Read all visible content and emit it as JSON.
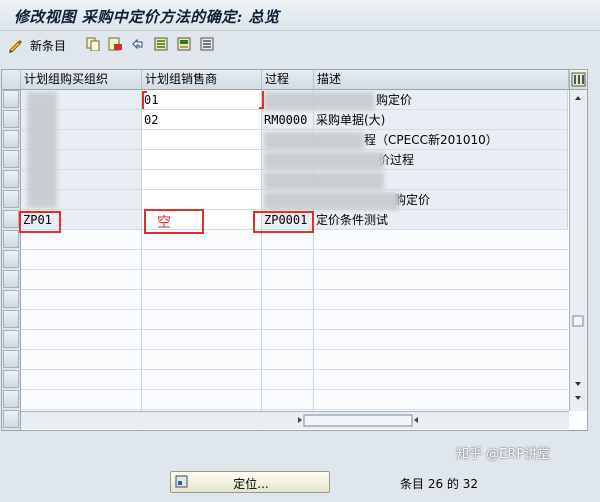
{
  "window": {
    "title": "修改视图 采购中定价方法的确定: 总览"
  },
  "toolbar": {
    "new_entries_label": "新条目",
    "icons": [
      "edit-glasses-icon",
      "copy-icon",
      "delete-icon",
      "undo-icon",
      "select-all-icon",
      "select-block-icon",
      "deselect-all-icon"
    ]
  },
  "table": {
    "columns": [
      "计划组购买组织",
      "计划组销售商",
      "过程",
      "描述"
    ],
    "rows": [
      {
        "purch_org": "",
        "vendor": "01",
        "procedure": "",
        "description": "购定价"
      },
      {
        "purch_org": "",
        "vendor": "02",
        "procedure": "RM0000",
        "description": "采购单据(大)"
      },
      {
        "purch_org": "",
        "vendor": "",
        "procedure": "",
        "description": "程（CPECC新201010）"
      },
      {
        "purch_org": "",
        "vendor": "",
        "procedure": "",
        "description": "价过程"
      },
      {
        "purch_org": "",
        "vendor": "",
        "procedure": "",
        "description": ""
      },
      {
        "purch_org": "",
        "vendor": "",
        "procedure": "",
        "description": "购定价"
      },
      {
        "purch_org": "ZP01",
        "vendor": "",
        "procedure": "ZP0001",
        "description": "定价条件测试"
      }
    ],
    "annotation_empty": "空",
    "empty_row_count": 10
  },
  "footer": {
    "position_button_label": "定位...",
    "entry_label": "条目 26 的 32"
  },
  "watermark": "知乎 @ERP讲堂",
  "colors": {
    "highlight_red": "#e0302a",
    "grid_bg": "#ffffff",
    "row_filled_bg": "#e8eef3",
    "header_bg": "#d2dce4"
  }
}
